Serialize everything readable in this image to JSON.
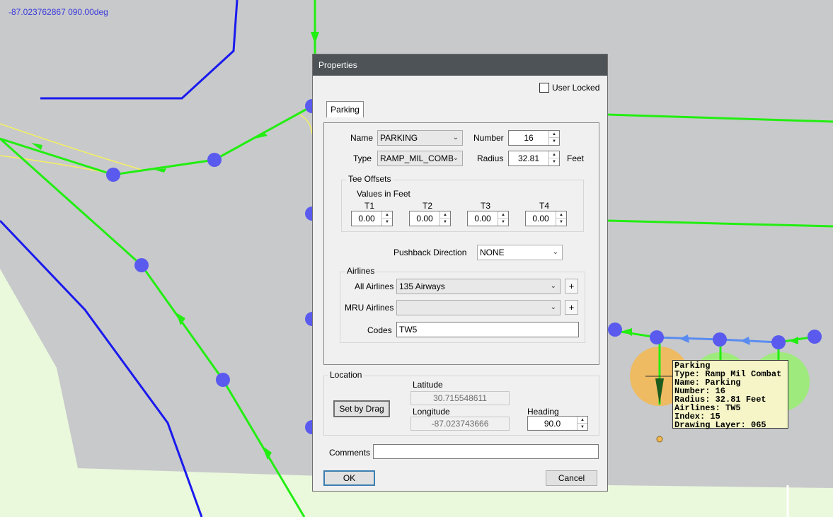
{
  "map": {
    "coord_readout": "-87.023762867 090.00deg",
    "colors": {
      "background": "#eaf8dc",
      "apron": "#c8c9cb",
      "taxiway": "#22ee11",
      "boundary": "#1a1aee",
      "node": "#5a5aee",
      "parking_selected": "#f5b850",
      "parking": "#98f070"
    }
  },
  "tooltip": {
    "lines": [
      "Parking",
      "Type: Ramp Mil Combat",
      "Name: Parking",
      "Number: 16",
      "Radius: 32.81 Feet",
      "Airlines: TW5",
      "Index: 15",
      "Drawing Layer: 065"
    ]
  },
  "dialog": {
    "title": "Properties",
    "user_locked_label": "User Locked",
    "user_locked": false,
    "tab": "Parking",
    "name_label": "Name",
    "name_value": "PARKING",
    "number_label": "Number",
    "number_value": "16",
    "type_label": "Type",
    "type_value": "RAMP_MIL_COMB",
    "radius_label": "Radius",
    "radius_value": "32.81",
    "radius_unit": "Feet",
    "tee_title": "Tee Offsets",
    "tee_units": "Values in Feet",
    "tees": [
      {
        "label": "T1",
        "value": "0.00"
      },
      {
        "label": "T2",
        "value": "0.00"
      },
      {
        "label": "T3",
        "value": "0.00"
      },
      {
        "label": "T4",
        "value": "0.00"
      }
    ],
    "pushback_label": "Pushback Direction",
    "pushback_value": "NONE",
    "airlines_title": "Airlines",
    "all_airlines_label": "All Airlines",
    "all_airlines_value": "135 Airways",
    "mru_label": "MRU Airlines",
    "mru_value": "",
    "plus": "+",
    "codes_label": "Codes",
    "codes_value": "TW5",
    "location_title": "Location",
    "set_by_drag": "Set by Drag",
    "latitude_label": "Latitude",
    "latitude_value": "30.715548611",
    "longitude_label": "Longitude",
    "longitude_value": "-87.023743666",
    "heading_label": "Heading",
    "heading_value": "90.0",
    "comments_label": "Comments",
    "comments_value": "",
    "ok": "OK",
    "cancel": "Cancel"
  }
}
